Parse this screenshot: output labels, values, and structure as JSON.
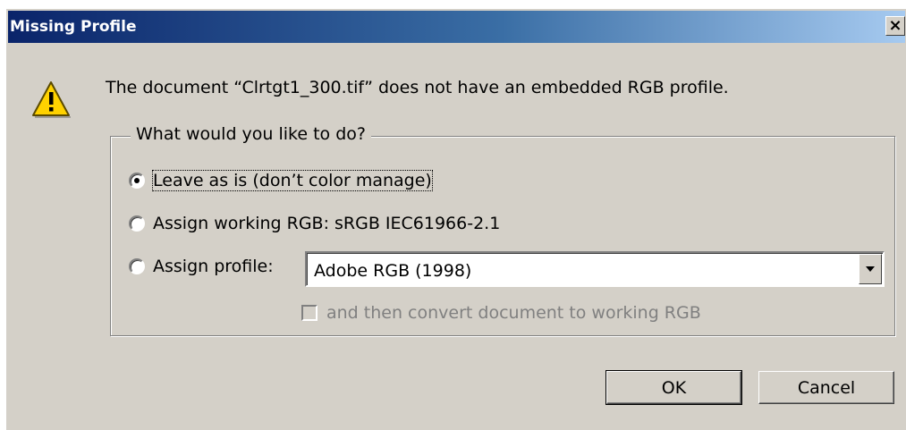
{
  "window": {
    "title": "Missing Profile",
    "close_glyph": "×"
  },
  "message": "The document “Clrtgt1_300.tif” does not have an embedded RGB profile.",
  "icons": {
    "warning": "warning-icon",
    "close": "close-icon",
    "dropdown": "chevron-down-icon"
  },
  "group": {
    "legend": "What would you like to do?",
    "options": [
      {
        "label": "Leave as is (don’t color manage)",
        "selected": true
      },
      {
        "label": "Assign working RGB:  sRGB IEC61966-2.1",
        "selected": false
      },
      {
        "label": "Assign profile:",
        "selected": false
      }
    ],
    "profile_select": {
      "value": "Adobe RGB (1998)"
    },
    "convert_checkbox": {
      "label": "and then convert document to working RGB",
      "checked": false,
      "enabled": false
    }
  },
  "buttons": {
    "ok": "OK",
    "cancel": "Cancel"
  },
  "colors": {
    "titlebar_start": "#0a246a",
    "titlebar_end": "#a6caf0",
    "dialog_bg": "#d4d0c8",
    "warning_fill": "#ffd200"
  }
}
